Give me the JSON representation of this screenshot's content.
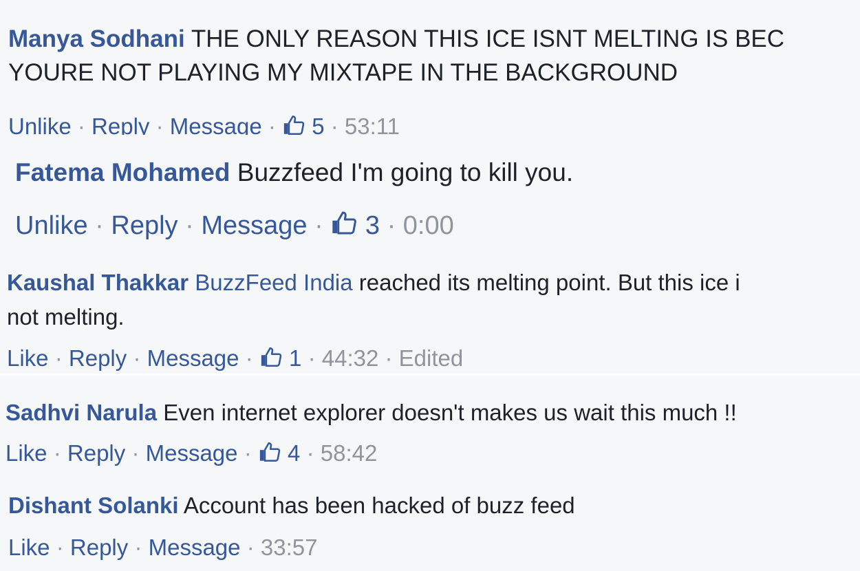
{
  "comments": [
    {
      "author": "Manya Sodhani",
      "text": "THE ONLY REASON THIS ICE ISNT MELTING IS BECAUSE YOURE NOT PLAYING MY MIXTAPE IN THE BACKGROUND",
      "text_line1": "THE ONLY REASON THIS ICE ISNT MELTING IS BEC",
      "text_line2": "YOURE NOT PLAYING MY MIXTAPE IN THE BACKGROUND",
      "like_action": "Unlike",
      "reply": "Reply",
      "message": "Message",
      "likes": "5",
      "time": "53:11"
    },
    {
      "author": "Fatema Mohamed",
      "text": "Buzzfeed I'm going to kill you.",
      "like_action": "Unlike",
      "reply": "Reply",
      "message": "Message",
      "likes": "3",
      "time": "0:00"
    },
    {
      "author": "Kaushal Thakkar",
      "mention": "BuzzFeed India",
      "text_line1": "reached its melting point. But this ice i",
      "text_line2": "not melting.",
      "like_action": "Like",
      "reply": "Reply",
      "message": "Message",
      "likes": "1",
      "time": "44:32",
      "edited": "Edited"
    },
    {
      "author": "Sadhvi Narula",
      "text": "Even internet explorer doesn't makes us wait this much !!",
      "like_action": "Like",
      "reply": "Reply",
      "message": "Message",
      "likes": "4",
      "time": "58:42"
    },
    {
      "author": "Dishant Solanki",
      "text": "Account has been hacked of buzz feed",
      "like_action": "Like",
      "reply": "Reply",
      "message": "Message",
      "time": "33:57"
    }
  ],
  "separator": "·",
  "icons": {
    "like": "thumbs-up-icon"
  },
  "colors": {
    "link": "#365899",
    "muted": "#90949c",
    "text": "#1d2129",
    "background": "#f6f7f9"
  }
}
